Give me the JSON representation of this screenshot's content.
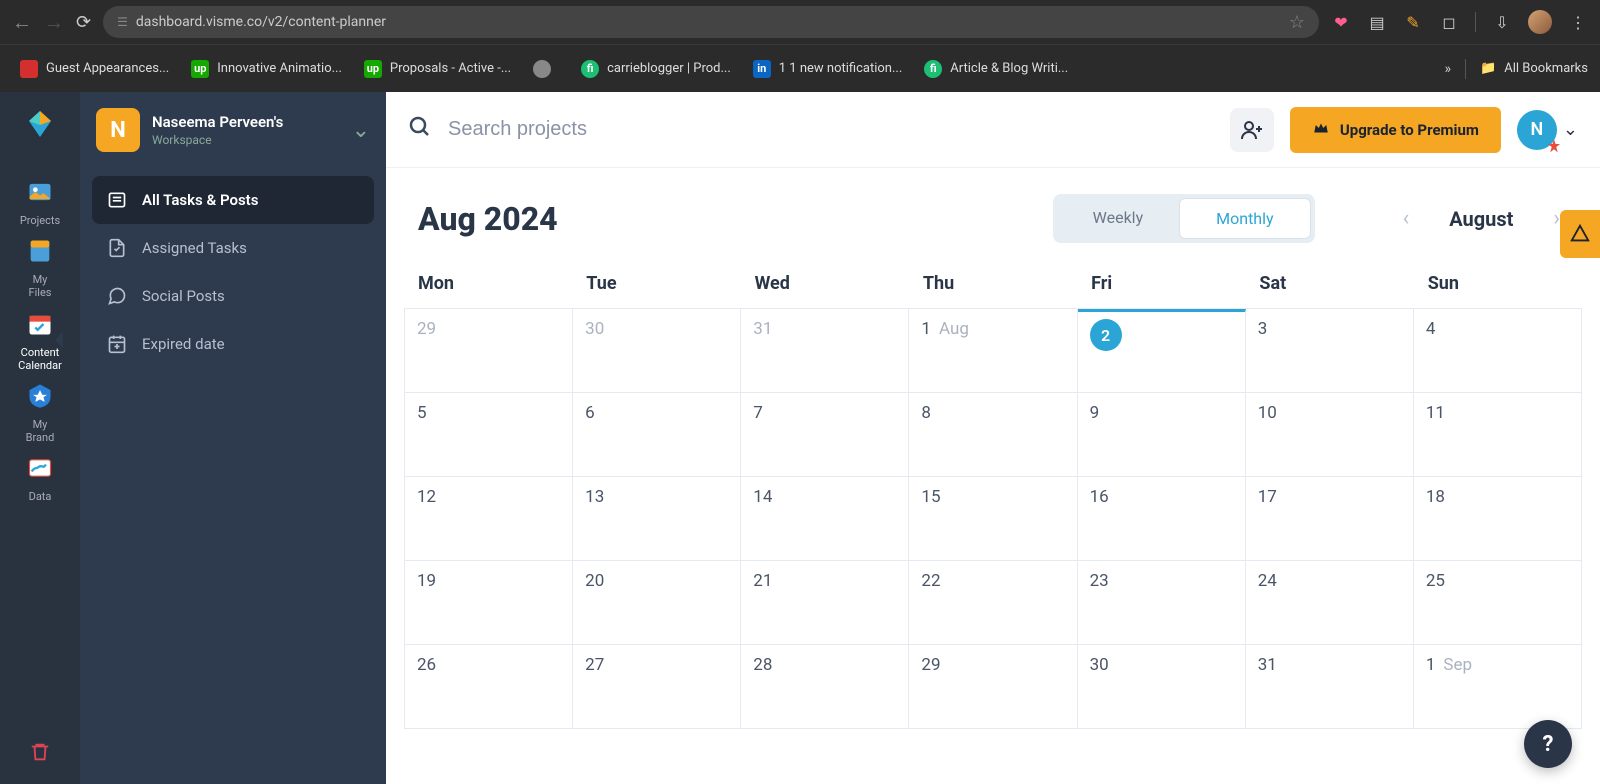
{
  "browser": {
    "url": "dashboard.visme.co/v2/content-planner",
    "bookmarks": [
      {
        "label": "Guest Appearances...",
        "iconClass": "red",
        "iconText": ""
      },
      {
        "label": "Innovative Animatio...",
        "iconClass": "green",
        "iconText": "up"
      },
      {
        "label": "Proposals - Active -...",
        "iconClass": "green",
        "iconText": "up"
      },
      {
        "label": "",
        "iconClass": "gray",
        "iconText": ""
      },
      {
        "label": "carrieblogger | Prod...",
        "iconClass": "fv",
        "iconText": "fi"
      },
      {
        "label": "1 1 new notification...",
        "iconClass": "li",
        "iconText": "in"
      },
      {
        "label": "Article & Blog Writi...",
        "iconClass": "fv",
        "iconText": "fi"
      }
    ],
    "allBookmarks": "All Bookmarks"
  },
  "navRail": {
    "items": [
      {
        "label": "Projects"
      },
      {
        "label": "My Files"
      },
      {
        "label": "Content Calendar"
      },
      {
        "label": "My Brand"
      },
      {
        "label": "Data"
      }
    ],
    "activeIndex": 2
  },
  "workspace": {
    "initial": "N",
    "name": "Naseema Perveen's",
    "subtitle": "Workspace"
  },
  "sidebar": {
    "items": [
      {
        "label": "All Tasks & Posts"
      },
      {
        "label": "Assigned Tasks"
      },
      {
        "label": "Social Posts"
      },
      {
        "label": "Expired date"
      }
    ],
    "activeIndex": 0
  },
  "topbar": {
    "searchPlaceholder": "Search projects",
    "upgradeLabel": "Upgrade to Premium",
    "profileInitial": "N"
  },
  "calendar": {
    "title": "Aug 2024",
    "viewWeekly": "Weekly",
    "viewMonthly": "Monthly",
    "activeView": "Monthly",
    "monthLabel": "August",
    "dow": [
      "Mon",
      "Tue",
      "Wed",
      "Thu",
      "Fri",
      "Sat",
      "Sun"
    ],
    "weeks": [
      [
        {
          "day": "29",
          "muted": true
        },
        {
          "day": "30",
          "muted": true
        },
        {
          "day": "31",
          "muted": true
        },
        {
          "day": "1",
          "monthLabel": "Aug"
        },
        {
          "day": "2",
          "today": true
        },
        {
          "day": "3"
        },
        {
          "day": "4"
        }
      ],
      [
        {
          "day": "5"
        },
        {
          "day": "6"
        },
        {
          "day": "7"
        },
        {
          "day": "8"
        },
        {
          "day": "9"
        },
        {
          "day": "10"
        },
        {
          "day": "11"
        }
      ],
      [
        {
          "day": "12"
        },
        {
          "day": "13"
        },
        {
          "day": "14"
        },
        {
          "day": "15"
        },
        {
          "day": "16"
        },
        {
          "day": "17"
        },
        {
          "day": "18"
        }
      ],
      [
        {
          "day": "19"
        },
        {
          "day": "20"
        },
        {
          "day": "21"
        },
        {
          "day": "22"
        },
        {
          "day": "23"
        },
        {
          "day": "24"
        },
        {
          "day": "25"
        }
      ],
      [
        {
          "day": "26"
        },
        {
          "day": "27"
        },
        {
          "day": "28"
        },
        {
          "day": "29"
        },
        {
          "day": "30"
        },
        {
          "day": "31"
        },
        {
          "day": "1",
          "monthLabel": "Sep"
        }
      ]
    ],
    "todayColumn": 4
  },
  "helpLabel": "?"
}
